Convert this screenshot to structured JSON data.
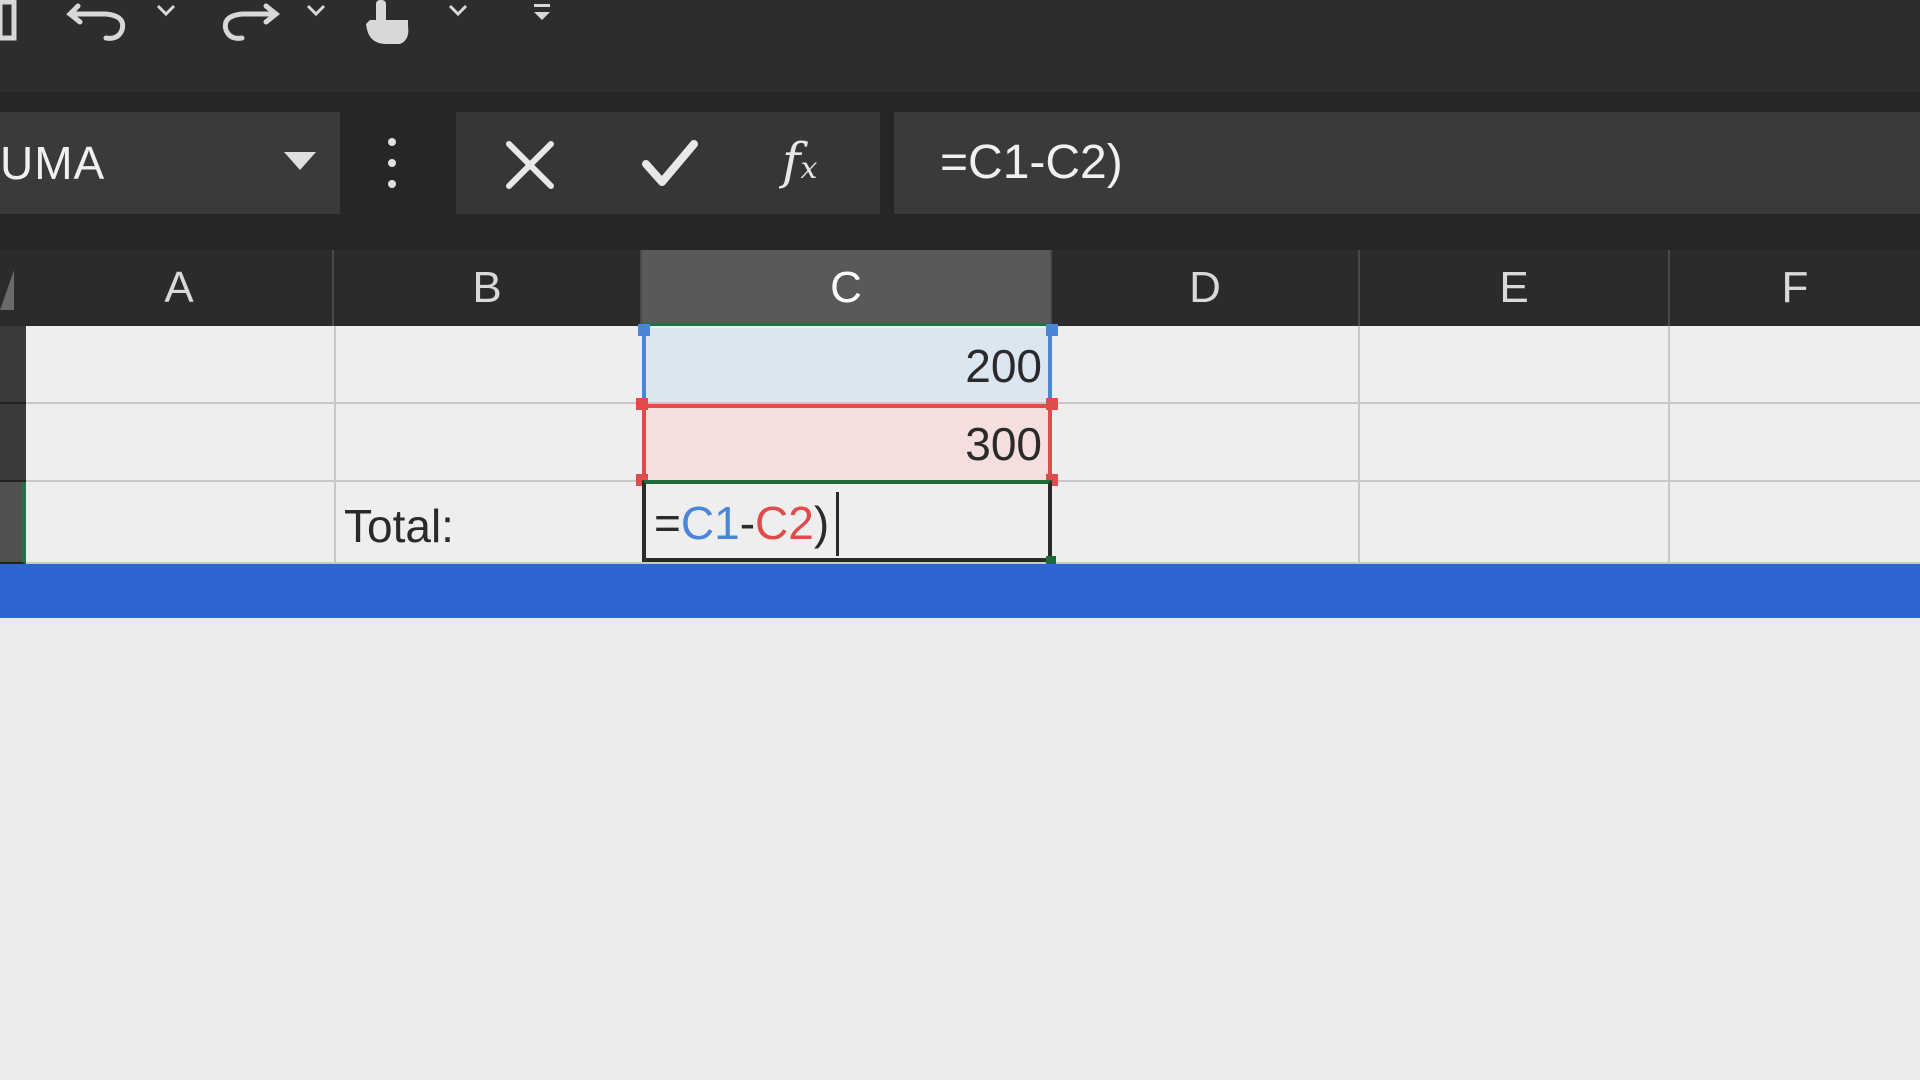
{
  "toolbar": {
    "buttons": [
      {
        "name": "save-icon"
      },
      {
        "name": "undo-icon"
      },
      {
        "name": "redo-icon"
      },
      {
        "name": "touch-mode-icon"
      },
      {
        "name": "customize-toolbar-icon"
      }
    ]
  },
  "formula_bar": {
    "name_box": "UMA",
    "formula": "=C1-C2)"
  },
  "columns": [
    "A",
    "B",
    "C",
    "D",
    "E",
    "F"
  ],
  "active_column": "C",
  "cells": {
    "C1": "200",
    "C2": "300",
    "B3": "Total:",
    "C3": {
      "equals": "=",
      "ref1": "C1",
      "op": "-",
      "ref2": "C2",
      "tail": ")"
    }
  },
  "colors": {
    "ref1": "#4a86d8",
    "ref2": "#e04b4b",
    "accent": "#217346",
    "bottom_bar": "#2d66d3"
  }
}
